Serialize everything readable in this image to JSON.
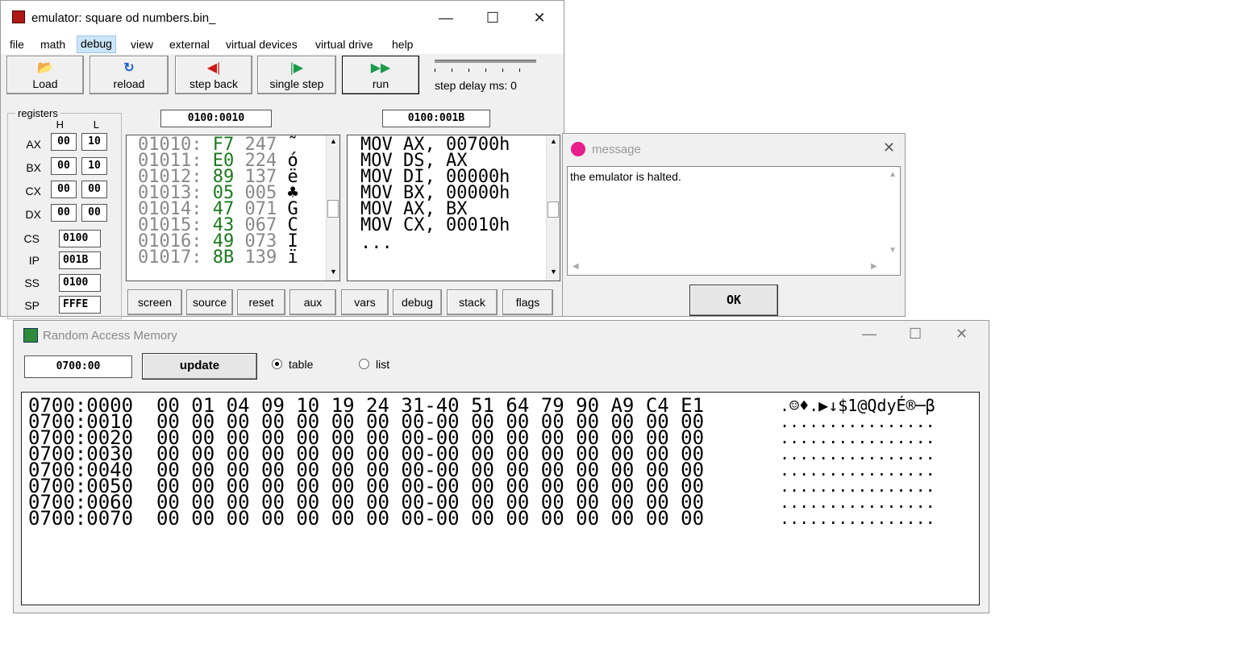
{
  "emulator": {
    "title": "emulator: square od numbers.bin_",
    "menu": [
      "file",
      "math",
      "debug",
      "view",
      "external",
      "virtual devices",
      "virtual drive",
      "help"
    ],
    "toolbar": {
      "load": "Load",
      "reload": "reload",
      "step_back": "step back",
      "single_step": "single step",
      "run": "run",
      "step_delay": "step delay ms: 0"
    },
    "registers": {
      "title": "registers",
      "h": "H",
      "l": "L",
      "rows": [
        {
          "name": "AX",
          "h": "00",
          "l": "10"
        },
        {
          "name": "BX",
          "h": "00",
          "l": "10"
        },
        {
          "name": "CX",
          "h": "00",
          "l": "00"
        },
        {
          "name": "DX",
          "h": "00",
          "l": "00"
        }
      ],
      "seg": [
        {
          "name": "CS",
          "value": "0100"
        },
        {
          "name": "IP",
          "value": "001B"
        },
        {
          "name": "SS",
          "value": "0100"
        },
        {
          "name": "SP",
          "value": "FFFE"
        }
      ]
    },
    "mem_addr": "0100:0010",
    "dis_addr": "0100:001B",
    "memory": [
      {
        "addr": "01010:",
        "hex": "F7",
        "dec": "247",
        "chr": "˜"
      },
      {
        "addr": "01011:",
        "hex": "E0",
        "dec": "224",
        "chr": "ó"
      },
      {
        "addr": "01012:",
        "hex": "89",
        "dec": "137",
        "chr": "ë"
      },
      {
        "addr": "01013:",
        "hex": "05",
        "dec": "005",
        "chr": "♣"
      },
      {
        "addr": "01014:",
        "hex": "47",
        "dec": "071",
        "chr": "G"
      },
      {
        "addr": "01015:",
        "hex": "43",
        "dec": "067",
        "chr": "C"
      },
      {
        "addr": "01016:",
        "hex": "49",
        "dec": "073",
        "chr": "I"
      },
      {
        "addr": "01017:",
        "hex": "8B",
        "dec": "139",
        "chr": "ï"
      }
    ],
    "disasm": [
      "MOV AX, 00700h",
      "MOV DS, AX",
      "MOV DI, 00000h",
      "MOV BX, 00000h",
      "MOV AX, BX",
      "MOV CX, 00010h",
      "..."
    ],
    "bottom_buttons": [
      "screen",
      "source",
      "reset",
      "aux",
      "vars",
      "debug",
      "stack",
      "flags"
    ]
  },
  "message": {
    "title": "message",
    "text": "the emulator is halted.",
    "ok": "OK"
  },
  "ram": {
    "title": "Random Access Memory",
    "address": "0700:00",
    "update": "update",
    "radio_table": "table",
    "radio_list": "list",
    "rows": [
      {
        "addr": "0700:0000",
        "bytes": "00 01 04 09 10 19 24 31-40 51 64 79 90 A9 C4 E1",
        "ascii": ".☺♦.▶↓$1@QdyÉ®─β"
      },
      {
        "addr": "0700:0010",
        "bytes": "00 00 00 00 00 00 00 00-00 00 00 00 00 00 00 00",
        "ascii": "................"
      },
      {
        "addr": "0700:0020",
        "bytes": "00 00 00 00 00 00 00 00-00 00 00 00 00 00 00 00",
        "ascii": "................"
      },
      {
        "addr": "0700:0030",
        "bytes": "00 00 00 00 00 00 00 00-00 00 00 00 00 00 00 00",
        "ascii": "................"
      },
      {
        "addr": "0700:0040",
        "bytes": "00 00 00 00 00 00 00 00-00 00 00 00 00 00 00 00",
        "ascii": "................"
      },
      {
        "addr": "0700:0050",
        "bytes": "00 00 00 00 00 00 00 00-00 00 00 00 00 00 00 00",
        "ascii": "................"
      },
      {
        "addr": "0700:0060",
        "bytes": "00 00 00 00 00 00 00 00-00 00 00 00 00 00 00 00",
        "ascii": "................"
      },
      {
        "addr": "0700:0070",
        "bytes": "00 00 00 00 00 00 00 00-00 00 00 00 00 00 00 00",
        "ascii": "................"
      }
    ]
  },
  "colors": {
    "accent": "#1a7a1a",
    "window_bg": "#f0f0f0",
    "menu_active": "#cce4f7"
  }
}
